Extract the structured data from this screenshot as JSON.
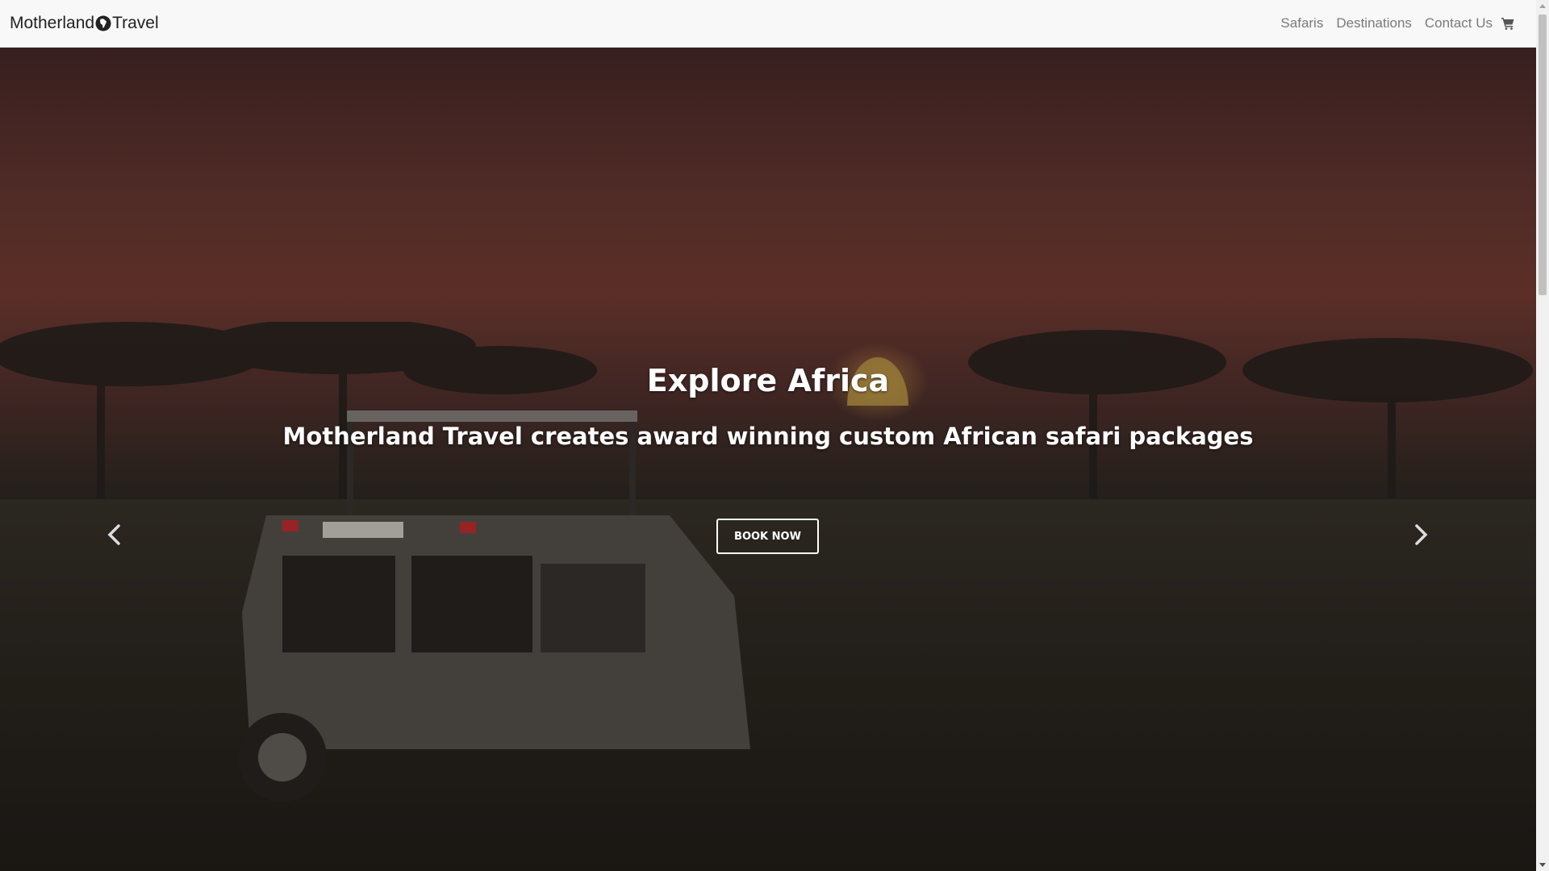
{
  "nav": {
    "brand_left": "Motherland",
    "brand_right": "Travel",
    "brand_icon": "globe-africa-icon",
    "links": [
      {
        "label": "Safaris"
      },
      {
        "label": "Destinations"
      },
      {
        "label": "Contact Us"
      }
    ],
    "cart_icon": "shopping-cart-icon"
  },
  "hero": {
    "title": "Explore Africa",
    "subtitle": "Motherland Travel creates award winning custom African safari packages",
    "cta_label": "BOOK NOW",
    "prev_icon": "chevron-left-icon",
    "next_icon": "chevron-right-icon"
  },
  "colors": {
    "navbar_bg": "#f8f8f8",
    "nav_link": "#7a7a7a",
    "brand_text": "#222222",
    "hero_text": "#ffffff"
  }
}
